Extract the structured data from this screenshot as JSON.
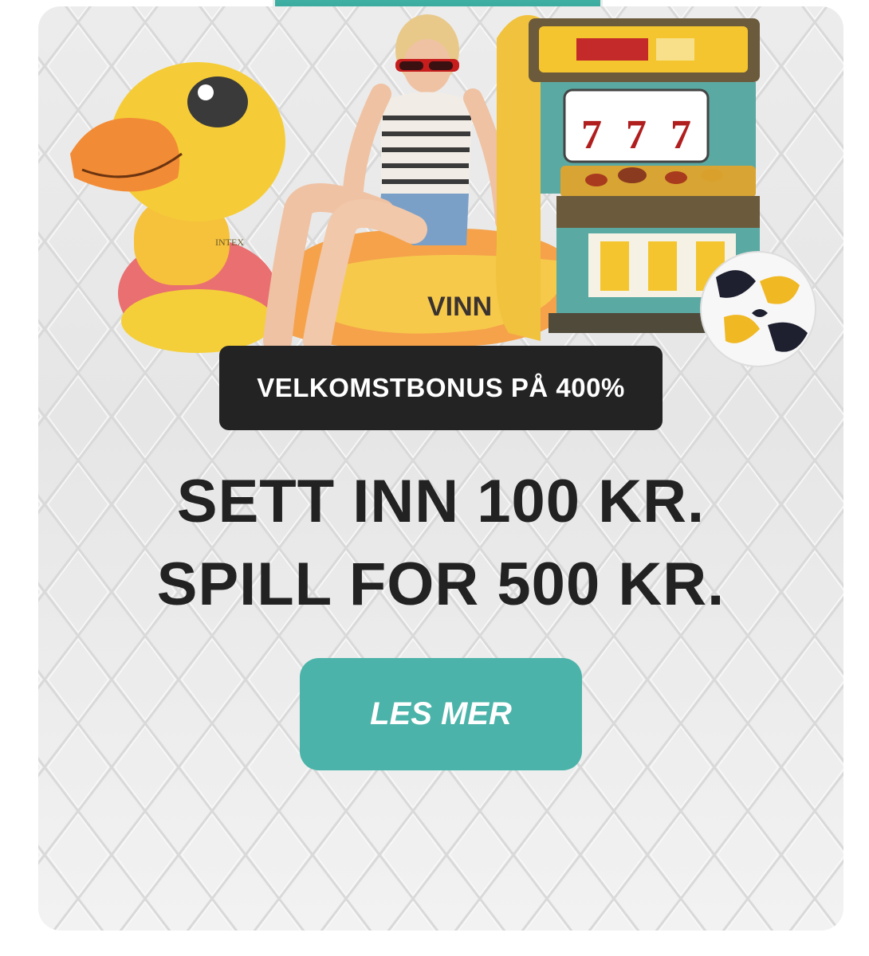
{
  "promo": {
    "badge_text": "VELKOMSTBONUS PÅ 400%",
    "headline_line1": "SETT INN 100 KR.",
    "headline_line2": "SPILL FOR 500 KR.",
    "cta_label": "LES MER",
    "float_brand_text": "VINN",
    "float_maker_text": "INTEX",
    "slot_reels": [
      "7",
      "7",
      "7"
    ]
  },
  "colors": {
    "accent": "#4bb3a9",
    "badge_bg": "#232323",
    "headline": "#222222",
    "card_bg": "#e8e8e8"
  }
}
